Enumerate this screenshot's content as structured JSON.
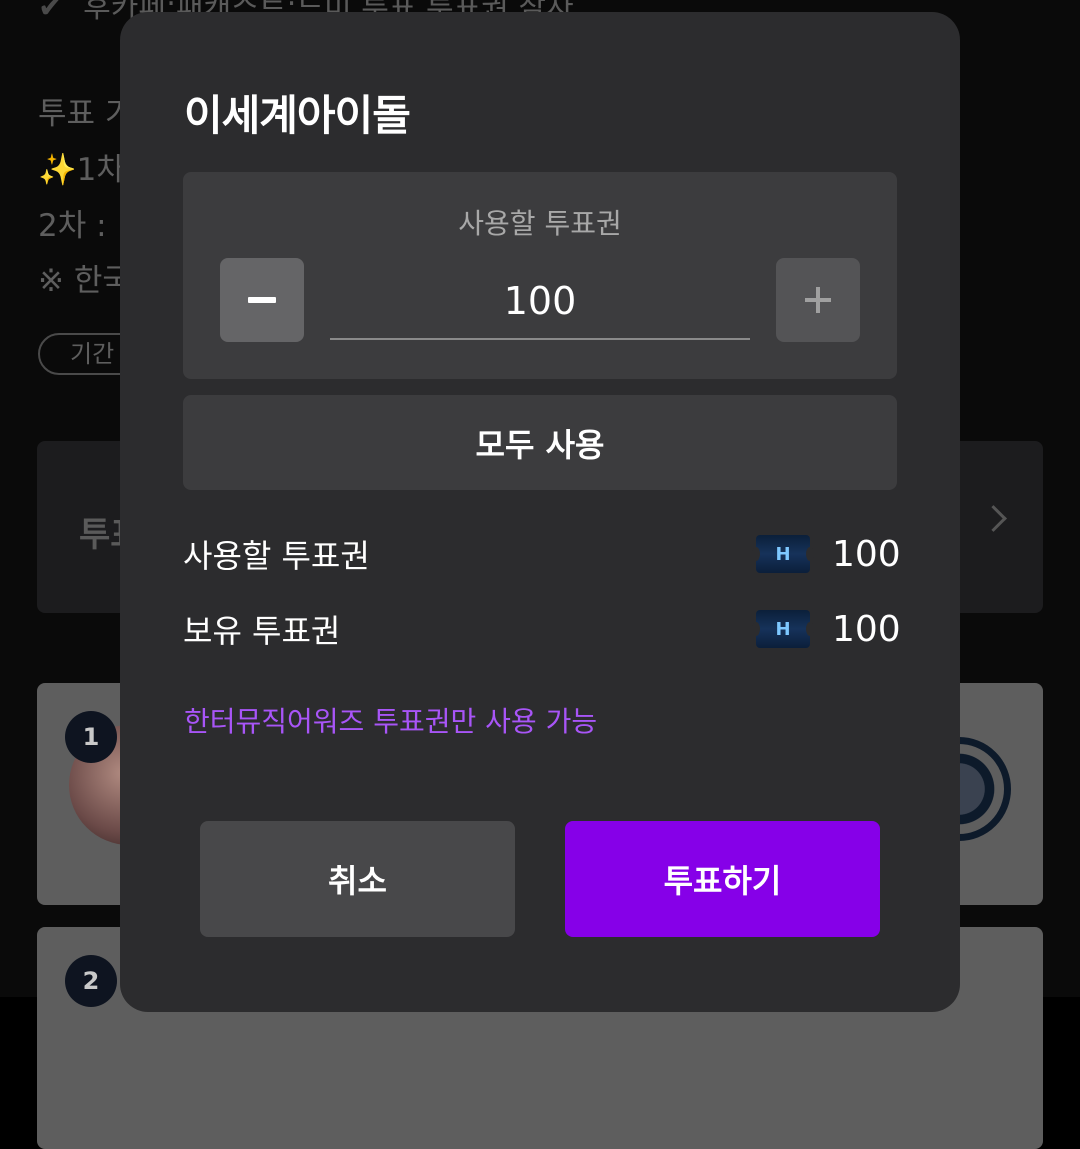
{
  "background": {
    "top_line": "후카페:패캐스트:드미 투표 투표권 참자",
    "lines": [
      "투표 기",
      "✨1차",
      "2차 :",
      "※ 한국"
    ],
    "period_pill": "기간",
    "card_title": "투표",
    "ranks": [
      "1",
      "2"
    ]
  },
  "modal": {
    "title": "이세계아이돌",
    "counter": {
      "label": "사용할 투표권",
      "value": "100"
    },
    "use_all_label": "모두 사용",
    "rows": [
      {
        "label": "사용할 투표권",
        "icon": "ticket-icon",
        "value": "100"
      },
      {
        "label": "보유 투표권",
        "icon": "ticket-icon",
        "value": "100"
      }
    ],
    "ticket_letter": "H",
    "notice": "한터뮤직어워즈 투표권만 사용 가능",
    "cancel_label": "취소",
    "vote_label": "투표하기"
  },
  "colors": {
    "accent": "#8600e8",
    "notice": "#a855f7",
    "modal_bg": "#2c2c2e"
  }
}
